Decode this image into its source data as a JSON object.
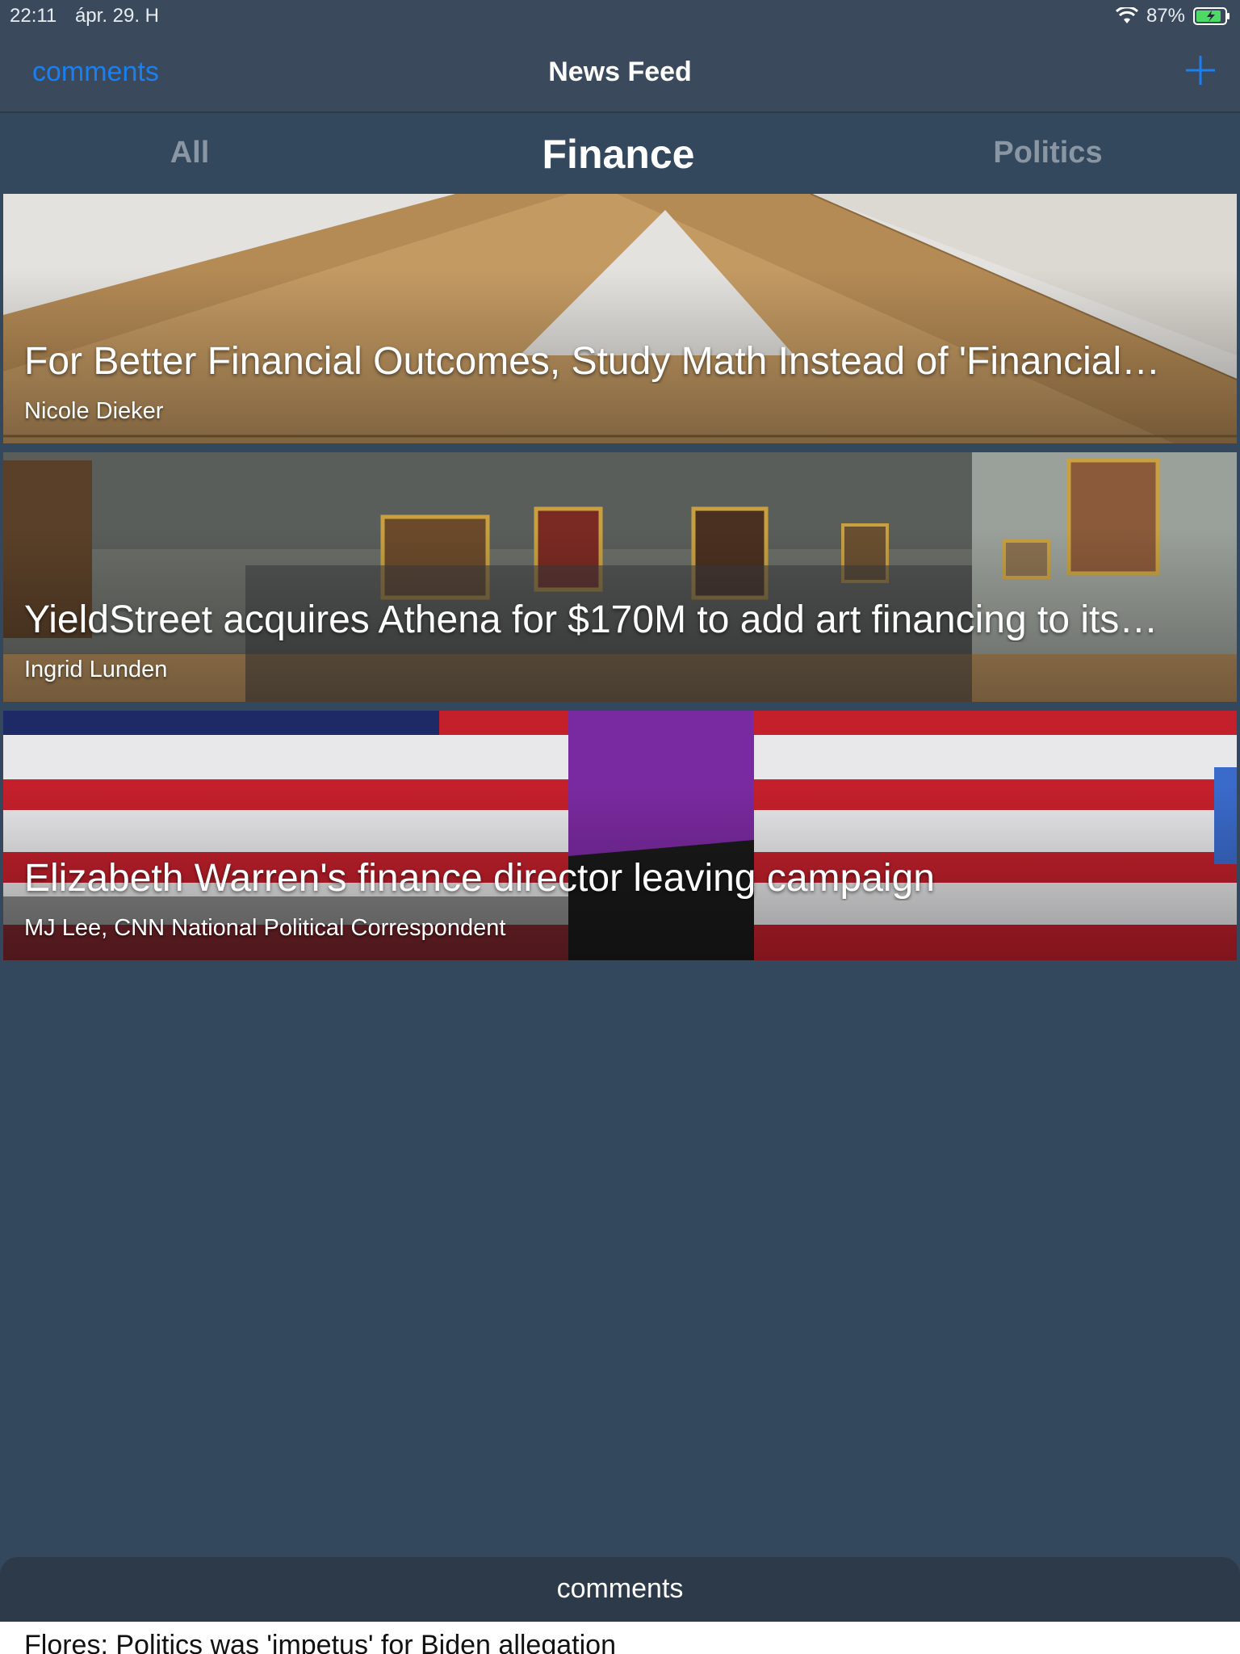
{
  "status_bar": {
    "time": "22:11",
    "date": "ápr. 29. H",
    "battery": "87%"
  },
  "nav": {
    "left_label": "comments",
    "title": "News Feed",
    "add_icon": "plus-icon",
    "accent": "#1a7ff0"
  },
  "tabs": [
    {
      "label": "All",
      "selected": false
    },
    {
      "label": "Finance",
      "selected": true
    },
    {
      "label": "Politics",
      "selected": false
    }
  ],
  "articles": [
    {
      "title": "For Better Financial Outcomes, Study Math Instead of 'Financial…",
      "author": "Nicole Dieker"
    },
    {
      "title": "YieldStreet acquires Athena for $170M to add art financing to its…",
      "author": "Ingrid Lunden"
    },
    {
      "title": "Elizabeth Warren's finance director leaving campaign",
      "author": "MJ Lee, CNN National Political Correspondent"
    }
  ],
  "bottom_sheet": {
    "title": "comments",
    "first_item": "Flores: Politics was 'impetus' for Biden allegation"
  }
}
